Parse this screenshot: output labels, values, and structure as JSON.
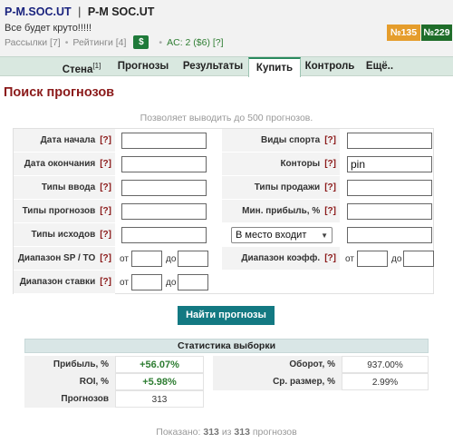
{
  "header": {
    "nick": "P-M.SOC.UT",
    "separator": "|",
    "nick2": "P-M SOC.UT",
    "motto": "Все будет круто!!!!!",
    "mailings": "Рассылки [7]",
    "dot1": "•",
    "ratings": "Рейтинги [4]",
    "dot2": "•",
    "money_icon": "$",
    "ac": "AC: 2 ($6) [?]",
    "badge1": "№135",
    "badge2": "№229",
    "badge_colors": {
      "badge1": "#e59d2c",
      "badge2": "#1f6d2a"
    }
  },
  "tabs": [
    {
      "label": "Стена",
      "sup": "[1]"
    },
    {
      "label": "Прогнозы",
      "sup": ""
    },
    {
      "label": "Результаты",
      "sup": ""
    },
    {
      "label": "Купить",
      "sup": ""
    },
    {
      "label": "Контроль",
      "sup": ""
    },
    {
      "label": "Ещё..",
      "sup": ""
    }
  ],
  "active_tab": "Купить",
  "page_title": "Поиск прогнозов",
  "subtitle": "Позволяет выводить до 500 прогнозов.",
  "form": {
    "help": "[?]",
    "date_start": "Дата начала",
    "date_end": "Дата окончания",
    "input_types": "Типы ввода",
    "forecast_types": "Типы прогнозов",
    "outcome_types": "Типы исходов",
    "sp_to_range": "Диапазон SP / TO",
    "stake_range": "Диапазон ставки",
    "sports": "Виды спорта",
    "bookmakers": "Конторы",
    "bookmakers_value": "pin",
    "sale_types": "Типы продажи",
    "min_profit": "Мин. прибыль, %",
    "place_select": "В место входит",
    "odds_range": "Диапазон коэфф.",
    "from": "от",
    "to": "до"
  },
  "find_button": "Найти прогнозы",
  "stats": {
    "title": "Статистика выборки",
    "profit_label": "Прибыль, %",
    "profit_value": "+56.07%",
    "roi_label": "ROI, %",
    "roi_value": "+5.98%",
    "count_label": "Прогнозов",
    "count_value": "313",
    "turnover_label": "Оборот, %",
    "turnover_value": "937.00%",
    "avg_label": "Ср. размер, %",
    "avg_value": "2.99%"
  },
  "footer": {
    "prefix": "Показано:",
    "shown": "313",
    "of": "из",
    "total": "313",
    "suffix": "прогнозов"
  }
}
